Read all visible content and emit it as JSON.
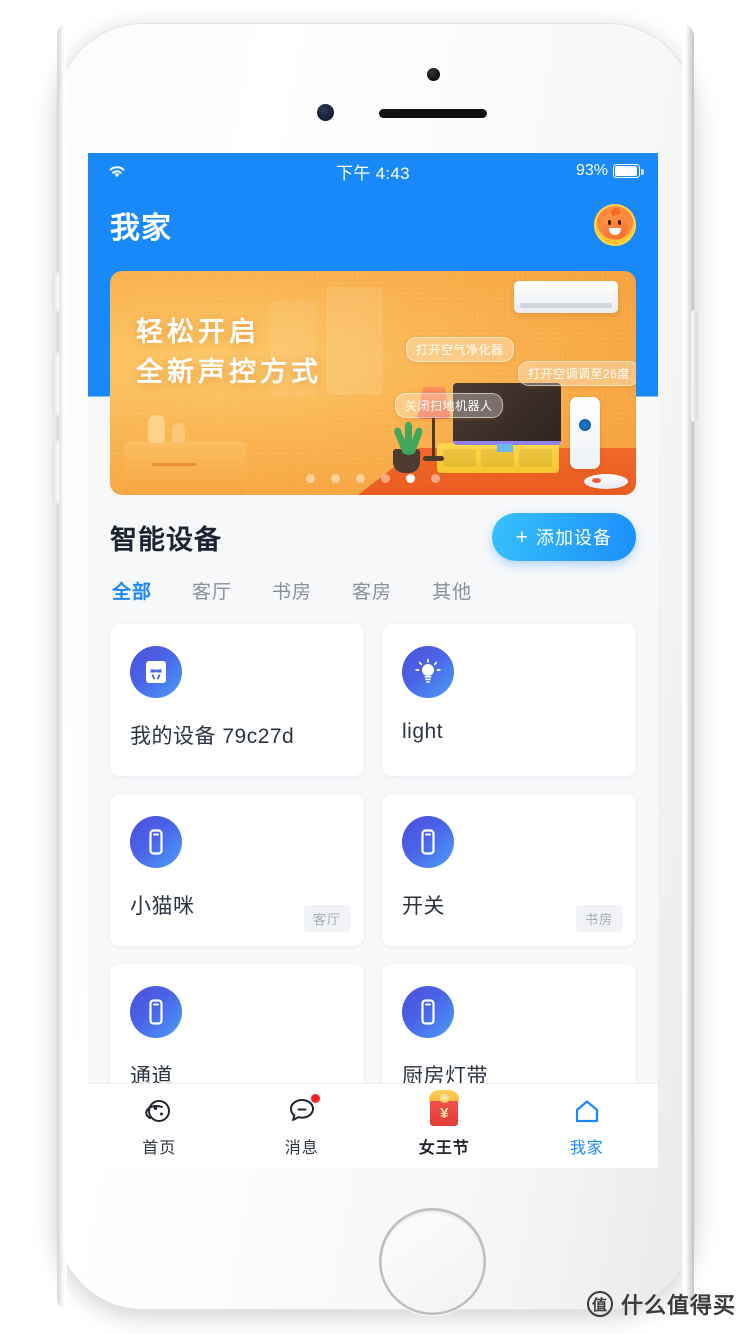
{
  "status_bar": {
    "wifi_icon": "wifi-icon",
    "time": "下午 4:43",
    "battery_percent": "93%",
    "battery_icon": "battery-icon"
  },
  "nav": {
    "title": "我家",
    "avatar_icon": "user-avatar"
  },
  "banner": {
    "headline_line1": "轻松开启",
    "headline_line2": "全新声控方式",
    "bubbles": [
      "打开空气净化器",
      "打开空调调至26度",
      "关闭扫地机器人"
    ],
    "dots_count": 6,
    "active_dot": 5,
    "bg_color": "#f5a13a"
  },
  "section": {
    "title": "智能设备",
    "add_button_label": "添加设备",
    "add_button_icon": "plus-icon",
    "accent_color": "#1989fa"
  },
  "room_tabs": [
    {
      "label": "全部",
      "active": true
    },
    {
      "label": "客厅",
      "active": false
    },
    {
      "label": "书房",
      "active": false
    },
    {
      "label": "客房",
      "active": false
    },
    {
      "label": "其他",
      "active": false
    }
  ],
  "devices": [
    {
      "name": "我的设备 79c27d",
      "icon": "socket-icon",
      "room": ""
    },
    {
      "name": "light",
      "icon": "lightbulb-icon",
      "room": ""
    },
    {
      "name": "小猫咪",
      "icon": "switch-icon",
      "room": "客厅"
    },
    {
      "name": "开关",
      "icon": "switch-icon",
      "room": "书房"
    },
    {
      "name": "通道",
      "icon": "switch-icon",
      "room": ""
    },
    {
      "name": "厨房灯带",
      "icon": "switch-icon",
      "room": ""
    }
  ],
  "tab_bar": [
    {
      "label": "首页",
      "icon": "planet-icon",
      "active": false,
      "badge": false
    },
    {
      "label": "消息",
      "icon": "chat-bubble-icon",
      "active": false,
      "badge": true
    },
    {
      "label": "女王节",
      "icon": "red-packet-icon",
      "active": false,
      "badge": false
    },
    {
      "label": "我家",
      "icon": "home-icon",
      "active": true,
      "badge": false
    }
  ],
  "watermark": {
    "badge": "值",
    "text": "什么值得买"
  }
}
